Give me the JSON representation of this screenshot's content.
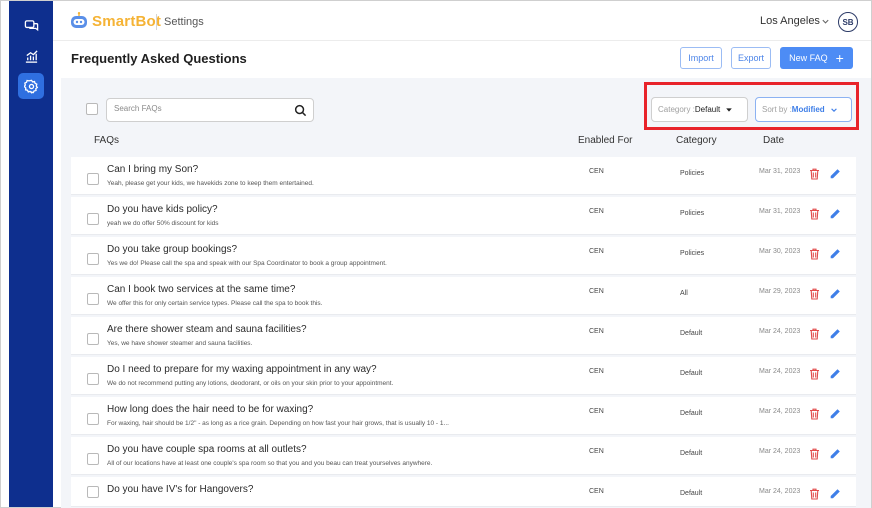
{
  "colors": {
    "sidebar": "#0e2f8e",
    "accent": "#4d8cf5",
    "brand": "#f5b335",
    "danger": "#e8232a"
  },
  "sidebar": {
    "items": [
      {
        "icon": "chat-icon",
        "active": false
      },
      {
        "icon": "analytics-icon",
        "active": false
      },
      {
        "icon": "settings-icon",
        "active": true
      }
    ]
  },
  "header": {
    "brand": "SmartBot",
    "section": "Settings",
    "location": "Los Angeles",
    "avatar": "SB"
  },
  "page": {
    "title": "Frequently Asked Questions",
    "import_label": "Import",
    "export_label": "Export",
    "new_label": "New FAQ"
  },
  "toolbar": {
    "search_placeholder": "Search FAQs",
    "category_label": "Category : ",
    "category_value": "Default",
    "sort_label": "Sort by : ",
    "sort_value": "Modified"
  },
  "table": {
    "headers": {
      "faqs": "FAQs",
      "enabled": "Enabled For",
      "category": "Category",
      "date": "Date"
    },
    "rows": [
      {
        "question": "Can I bring my Son?",
        "answer": "Yeah, please get your kids, we havekids zone to keep them entertained.",
        "enabled": "CEN",
        "category": "Policies",
        "date": "Mar 31, 2023"
      },
      {
        "question": "Do you have kids policy?",
        "answer": "yeah we do offer 50% discount for kids",
        "enabled": "CEN",
        "category": "Policies",
        "date": "Mar 31, 2023"
      },
      {
        "question": "Do you take group bookings?",
        "answer": "Yes we do! Please call the spa and speak with our Spa Coordinator to book a group appointment.",
        "enabled": "CEN",
        "category": "Policies",
        "date": "Mar 30, 2023"
      },
      {
        "question": "Can I book two services at the same time?",
        "answer": "We offer this for only certain service types. Please call the spa to book this.",
        "enabled": "CEN",
        "category": "All",
        "date": "Mar 29, 2023"
      },
      {
        "question": "Are there shower steam and sauna facilities?",
        "answer": "Yes, we have shower steamer and sauna facilities.",
        "enabled": "CEN",
        "category": "Default",
        "date": "Mar 24, 2023"
      },
      {
        "question": "Do I need to prepare for my waxing appointment in any way?",
        "answer": "We do not recommend putting any lotions, deodorant, or oils on your skin prior to your appointment.",
        "enabled": "CEN",
        "category": "Default",
        "date": "Mar 24, 2023"
      },
      {
        "question": "How long does the hair need to be for waxing?",
        "answer": "For waxing, hair should be 1/2\" - as long as a rice grain. Depending on how fast your hair grows, that is usually 10 - 1...",
        "enabled": "CEN",
        "category": "Default",
        "date": "Mar 24, 2023"
      },
      {
        "question": "Do you have couple spa rooms at all outlets?",
        "answer": "All of our locations have at least one couple's spa room so that you and you beau can treat yourselves anywhere.",
        "enabled": "CEN",
        "category": "Default",
        "date": "Mar 24, 2023"
      },
      {
        "question": "Do you have IV's for Hangovers?",
        "answer": "",
        "enabled": "CEN",
        "category": "Default",
        "date": "Mar 24, 2023"
      }
    ]
  }
}
